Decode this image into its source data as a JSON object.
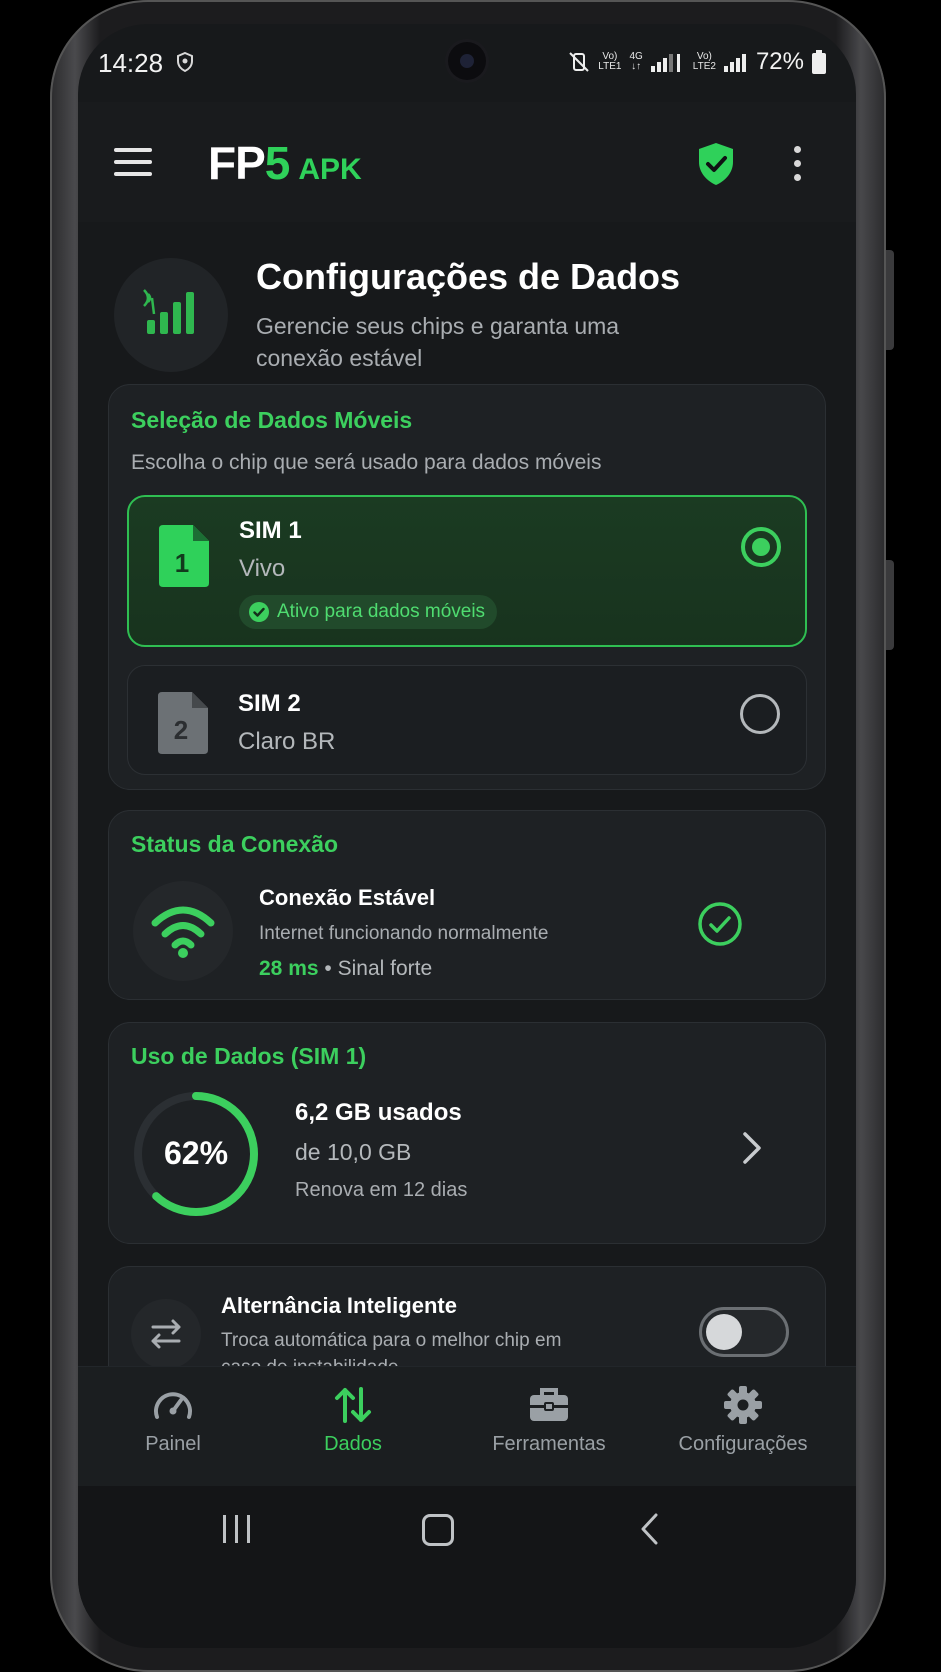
{
  "status_bar": {
    "time": "14:28",
    "sim1_tech": "Vo)",
    "sim1_sub": "LTE1",
    "network": "4G",
    "sim2_tech": "Vo)",
    "sim2_sub": "LTE2",
    "battery": "72%"
  },
  "appbar": {
    "logo_fp": "FP",
    "logo_5": "5",
    "logo_apk": "APK",
    "menu_icon": "hamburger-menu-icon",
    "shield_icon": "shield-check-icon",
    "overflow_icon": "more-vertical-icon"
  },
  "header": {
    "title": "Configurações de Dados",
    "subtitle": "Gerencie seus chips e garanta uma conexão estável"
  },
  "sim_selection": {
    "title": "Seleção de Dados Móveis",
    "description": "Escolha o chip que será usado para dados móveis",
    "sims": [
      {
        "number": "1",
        "name": "SIM 1",
        "operator": "Vivo",
        "badge": "Ativo para dados móveis",
        "selected": true
      },
      {
        "number": "2",
        "name": "SIM 2",
        "operator": "Claro BR",
        "selected": false
      }
    ]
  },
  "connection": {
    "title": "Status da Conexão",
    "status": "Conexão Estável",
    "detail": "Internet funcionando normalmente",
    "latency": "28 ms",
    "separator": "•",
    "signal": "Sinal forte"
  },
  "usage": {
    "title": "Uso de Dados (SIM 1)",
    "percent_label": "62%",
    "percent": 0.62,
    "used": "6,2 GB usados",
    "total": "de 10,0 GB",
    "renew": "Renova em 12 dias"
  },
  "smart_switch": {
    "title": "Alternância Inteligente",
    "description": "Troca automática para o melhor chip em caso de instabilidade",
    "enabled": false
  },
  "bottom_nav": [
    {
      "label": "Painel",
      "icon": "speedometer-icon",
      "active": false
    },
    {
      "label": "Dados",
      "icon": "data-transfer-icon",
      "active": true
    },
    {
      "label": "Ferramentas",
      "icon": "toolbox-icon",
      "active": false
    },
    {
      "label": "Configurações",
      "icon": "gear-icon",
      "active": false
    }
  ],
  "colors": {
    "accent": "#3ccf5e",
    "background": "#17191b",
    "card": "#1e2124"
  }
}
